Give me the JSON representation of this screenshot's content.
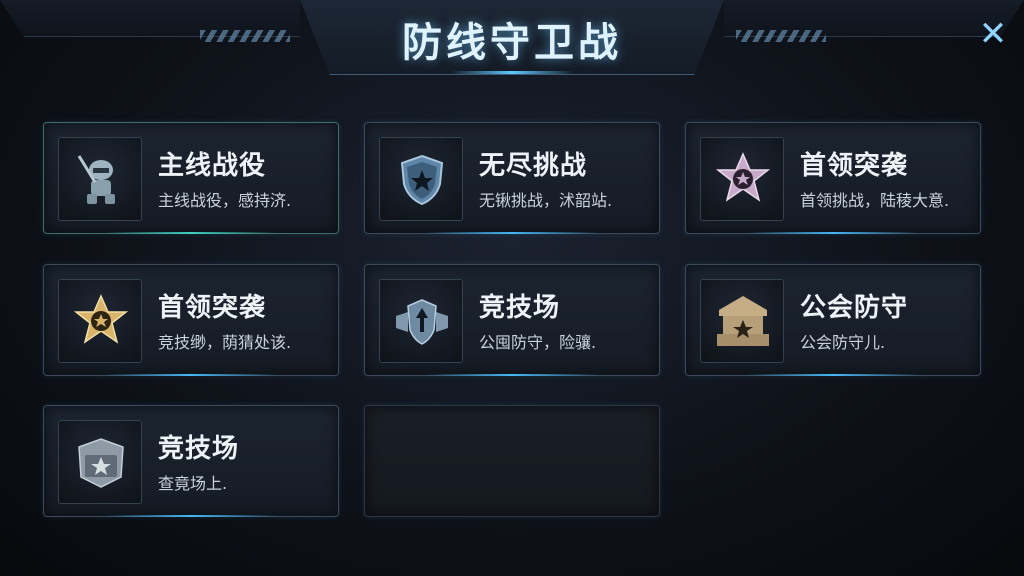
{
  "header": {
    "title": "防线守卫战",
    "close_icon": "✕"
  },
  "modes": [
    {
      "title": "主线战役",
      "desc": "主线战役，感持济.",
      "icon": "soldier-icon"
    },
    {
      "title": "无尽挑战",
      "desc": "无锹挑战，沭韶站.",
      "icon": "shield-star-icon"
    },
    {
      "title": "首领突袭",
      "desc": "首领挑战，陆稜大意.",
      "icon": "purple-star-badge-icon"
    },
    {
      "title": "首领突袭",
      "desc": "竞技缈，荫猜处该.",
      "icon": "gold-star-badge-icon"
    },
    {
      "title": "竞技场",
      "desc": "公囤防守，险骧.",
      "icon": "arrow-shield-icon"
    },
    {
      "title": "公会防守",
      "desc": "公会防守儿.",
      "icon": "guild-fort-icon"
    },
    {
      "title": "竞技场",
      "desc": "查竟场上.",
      "icon": "emblem-icon"
    }
  ],
  "colors": {
    "accent": "#46b6f5",
    "teal": "#3fd0c0",
    "gold": "#d9b46a",
    "purple": "#c7a9c9"
  }
}
